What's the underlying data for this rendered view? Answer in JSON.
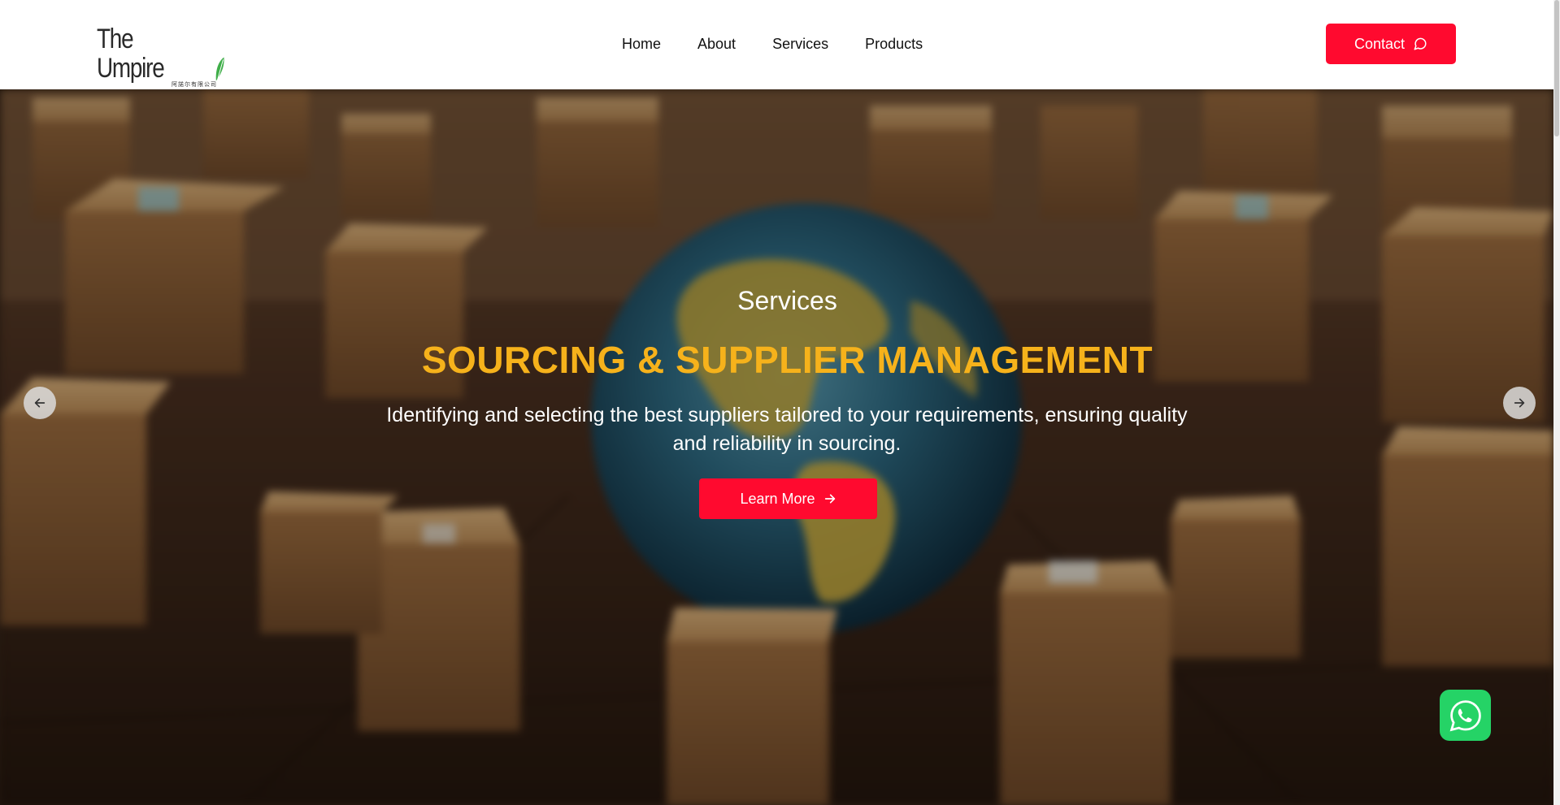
{
  "header": {
    "logo_text": "The Umpire",
    "logo_subtext": "阿諾尔有限公司",
    "nav": [
      {
        "label": "Home"
      },
      {
        "label": "About"
      },
      {
        "label": "Services"
      },
      {
        "label": "Products"
      }
    ],
    "contact_label": "Contact"
  },
  "hero": {
    "kicker": "Services",
    "title": "SOURCING & SUPPLIER MANAGEMENT",
    "description": "Identifying and selecting the best suppliers tailored to your requirements, ensuring quality and reliability in sourcing.",
    "button_label": "Learn More"
  },
  "icons": {
    "contact": "chat-bubble-icon",
    "learn_more": "arrow-right-icon",
    "prev": "arrow-left-icon",
    "next": "arrow-right-icon",
    "whatsapp": "whatsapp-icon"
  },
  "colors": {
    "accent": "#ff0a2f",
    "title_yellow": "#f6b21b",
    "whatsapp_green": "#25d366"
  }
}
